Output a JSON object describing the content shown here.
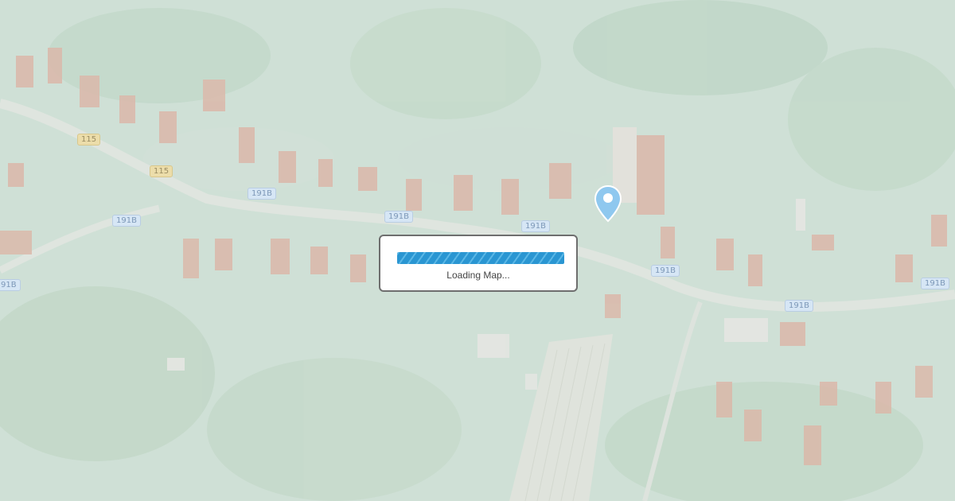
{
  "map": {
    "type": "satellite",
    "road_labels": [
      {
        "text": "115",
        "style": "yellow"
      },
      {
        "text": "115",
        "style": "yellow"
      },
      {
        "text": "191B",
        "style": "blue"
      },
      {
        "text": "191B",
        "style": "blue"
      },
      {
        "text": "191B",
        "style": "blue"
      },
      {
        "text": "191B",
        "style": "blue"
      },
      {
        "text": "191B",
        "style": "blue"
      },
      {
        "text": "191B",
        "style": "blue"
      },
      {
        "text": "191B",
        "style": "blue"
      },
      {
        "text": "91B",
        "style": "blue"
      }
    ],
    "marker_icon": "map-pin-icon",
    "marker_color": "#8fc8ef"
  },
  "loading": {
    "text": "Loading Map...",
    "progress_fraction": 1.0,
    "bar_color": "#2f9fd8"
  }
}
